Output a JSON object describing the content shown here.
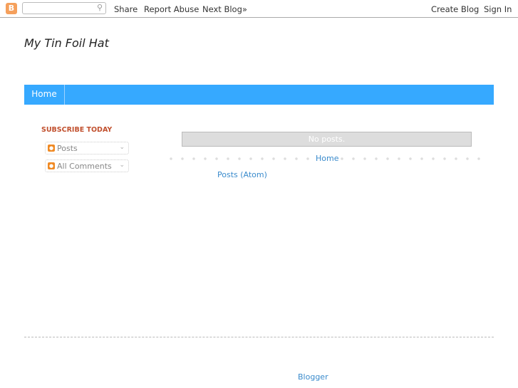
{
  "navbar": {
    "logo": "B",
    "search_placeholder": "",
    "search_icon": "magnifier-icon",
    "share": "Share",
    "report_abuse": "Report Abuse",
    "next_blog": "Next Blog»",
    "create_blog": "Create Blog",
    "sign_in": "Sign In"
  },
  "header": {
    "title": "My Tin Foil Hat"
  },
  "menu": {
    "tabs": [
      {
        "label": "Home"
      }
    ],
    "color": "#36a9ff"
  },
  "sidebar": {
    "heading": "SUBSCRIBE TODAY",
    "feeds": [
      {
        "label": "Posts"
      },
      {
        "label": "All Comments"
      }
    ]
  },
  "main": {
    "no_posts": "No posts.",
    "home_link": "Home",
    "atom_link": "Posts (Atom)"
  },
  "footer": {
    "attribution": "Blogger"
  }
}
